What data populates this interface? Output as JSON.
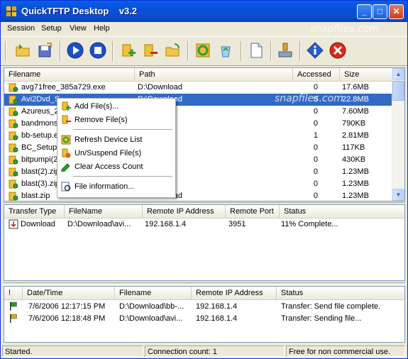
{
  "window": {
    "title": "QuickTFTP Desktop    v3.2"
  },
  "watermark": "snapfiles.com",
  "menu": [
    "Session",
    "Setup",
    "View",
    "Help"
  ],
  "toolbar": {
    "buttons": [
      "open-folder",
      "save-disk",
      "play",
      "stop",
      "add-file",
      "remove-file",
      "refresh",
      "recycle",
      "refresh-folder",
      "document",
      "network",
      "info",
      "close"
    ]
  },
  "files": {
    "columns": [
      "Filename",
      "Path",
      "Accessed",
      "Size"
    ],
    "rows": [
      {
        "name": "avg71free_385a729.exe",
        "path": "D:\\Download",
        "accessed": "0",
        "size": "17.6MB",
        "selected": false
      },
      {
        "name": "Avi2Dvd_S",
        "path": "D:\\Download",
        "accessed": "0",
        "size": "22.8MB",
        "selected": true
      },
      {
        "name": "Azureus_2",
        "path": "",
        "accessed": "0",
        "size": "7.60MB",
        "selected": false
      },
      {
        "name": "bandmonst",
        "path": "",
        "accessed": "0",
        "size": "790KB",
        "selected": false
      },
      {
        "name": "bb-setup.e",
        "path": "",
        "accessed": "1",
        "size": "2.81MB",
        "selected": false
      },
      {
        "name": "BC_Setup.",
        "path": "",
        "accessed": "0",
        "size": "117KB",
        "selected": false
      },
      {
        "name": "bitpumpi(2)",
        "path": "",
        "accessed": "0",
        "size": "430KB",
        "selected": false
      },
      {
        "name": "blast(2).zip",
        "path": "",
        "accessed": "0",
        "size": "1.23MB",
        "selected": false
      },
      {
        "name": "blast(3).zip",
        "path": "",
        "accessed": "0",
        "size": "1.23MB",
        "selected": false
      },
      {
        "name": "blast.zip",
        "path": "D:\\Download",
        "accessed": "0",
        "size": "1.23MB",
        "selected": false
      }
    ]
  },
  "context_menu": {
    "items": [
      {
        "label": "Add File(s)...",
        "icon": "add-file-icon"
      },
      {
        "label": "Remove File(s)",
        "icon": "remove-file-icon"
      },
      {
        "label": "Refresh Device List",
        "icon": "refresh-icon"
      },
      {
        "label": "Un/Suspend File(s)",
        "icon": "suspend-icon"
      },
      {
        "label": "Clear Access Count",
        "icon": "clear-icon"
      },
      {
        "label": "File information...",
        "icon": "info-icon"
      }
    ]
  },
  "transfers": {
    "columns": [
      "Transfer Type",
      "FileName",
      "Remote IP Address",
      "Remote Port",
      "Status"
    ],
    "rows": [
      {
        "type": "Download",
        "file": "D:\\Download\\avi...",
        "ip": "192.168.1.4",
        "port": "3951",
        "status": "11% Complete..."
      }
    ]
  },
  "log": {
    "columns": [
      "!",
      "Date/Time",
      "Filename",
      "Remote IP Address",
      "Status"
    ],
    "rows": [
      {
        "datetime": "7/6/2006 12:17:15 PM",
        "file": "D:\\Download\\bb-...",
        "ip": "192.168.1.4",
        "status": "Transfer: Send file complete.",
        "flag_color": "#22A022"
      },
      {
        "datetime": "7/6/2006 12:18:48 PM",
        "file": "D:\\Download\\avi...",
        "ip": "192.168.1.4",
        "status": "Transfer: Sending file...",
        "flag_color": "#C8B400"
      }
    ]
  },
  "status": {
    "left": "Started.",
    "connections": "Connection count: 1",
    "license": "Free for non commercial use."
  }
}
